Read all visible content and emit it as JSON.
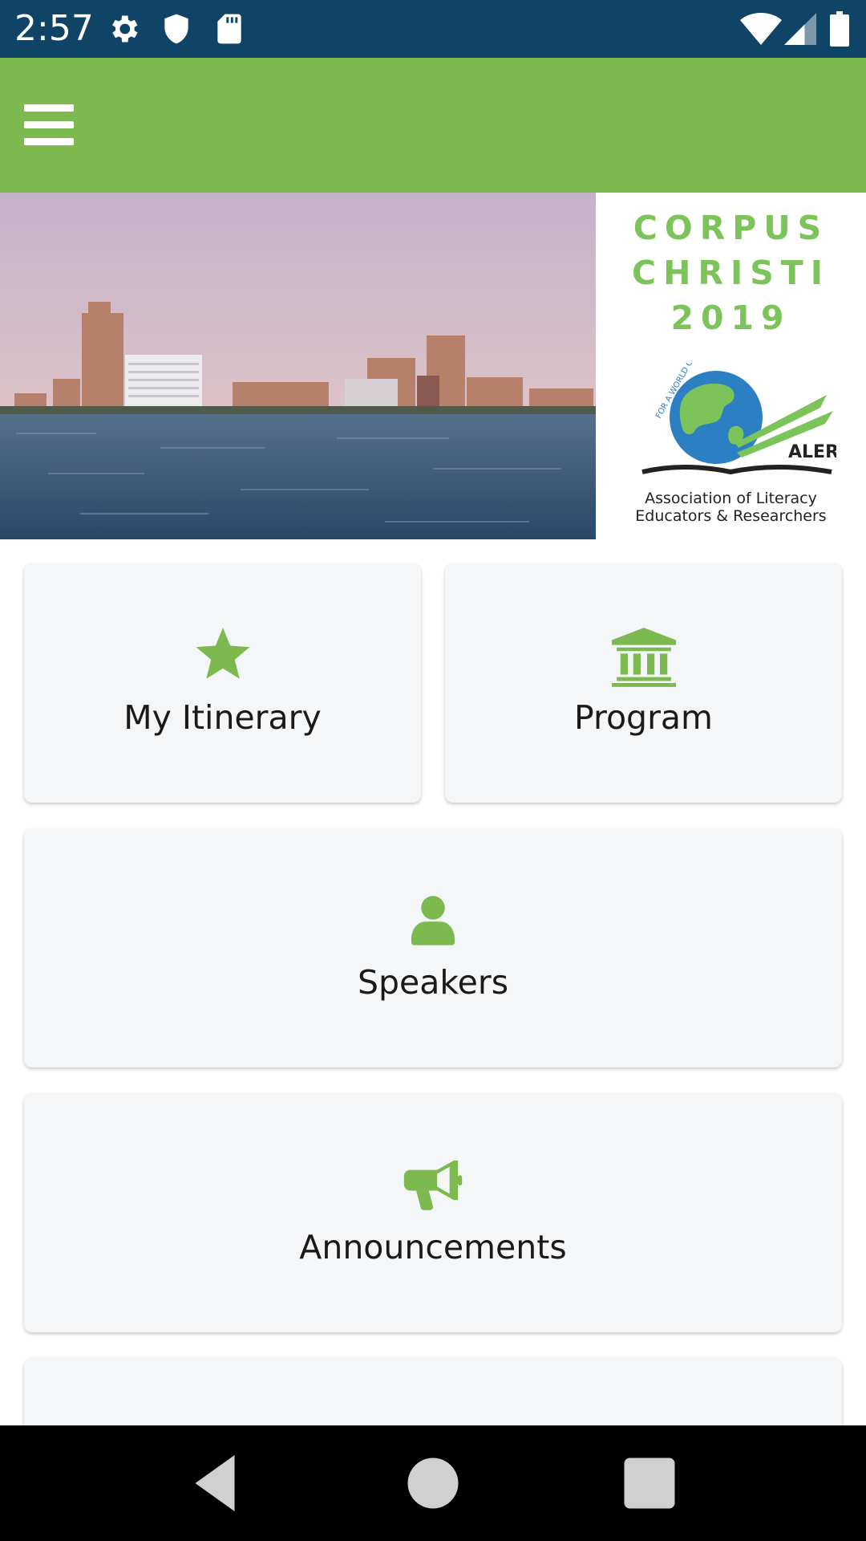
{
  "status_bar": {
    "time": "2:57",
    "left_icons": [
      "gear-icon",
      "shield-icon",
      "sd-card-icon"
    ],
    "right_icons": [
      "wifi-icon",
      "cell-signal-icon",
      "battery-icon"
    ]
  },
  "app_bar": {
    "menu_icon": "hamburger-menu-icon",
    "color": "#7cb94e"
  },
  "banner": {
    "city_line1": "CORPUS",
    "city_line2": "CHRISTI",
    "year": "2019",
    "logo_arc_text": "FOR A WORLD OF LITERACY",
    "logo_name": "ALER",
    "org_line1": "Association of Literacy",
    "org_line2": "Educators & Researchers"
  },
  "menu": {
    "my_itinerary": {
      "label": "My Itinerary",
      "icon": "star-icon"
    },
    "program": {
      "label": "Program",
      "icon": "institution-icon"
    },
    "speakers": {
      "label": "Speakers",
      "icon": "person-icon"
    },
    "announcements": {
      "label": "Announcements",
      "icon": "megaphone-icon"
    }
  },
  "nav_bar": {
    "back": "back-icon",
    "home": "home-icon",
    "recents": "recents-icon"
  },
  "colors": {
    "accent": "#7cb94e",
    "status_bar": "#0f4466",
    "card_bg": "#f5f6f8"
  }
}
